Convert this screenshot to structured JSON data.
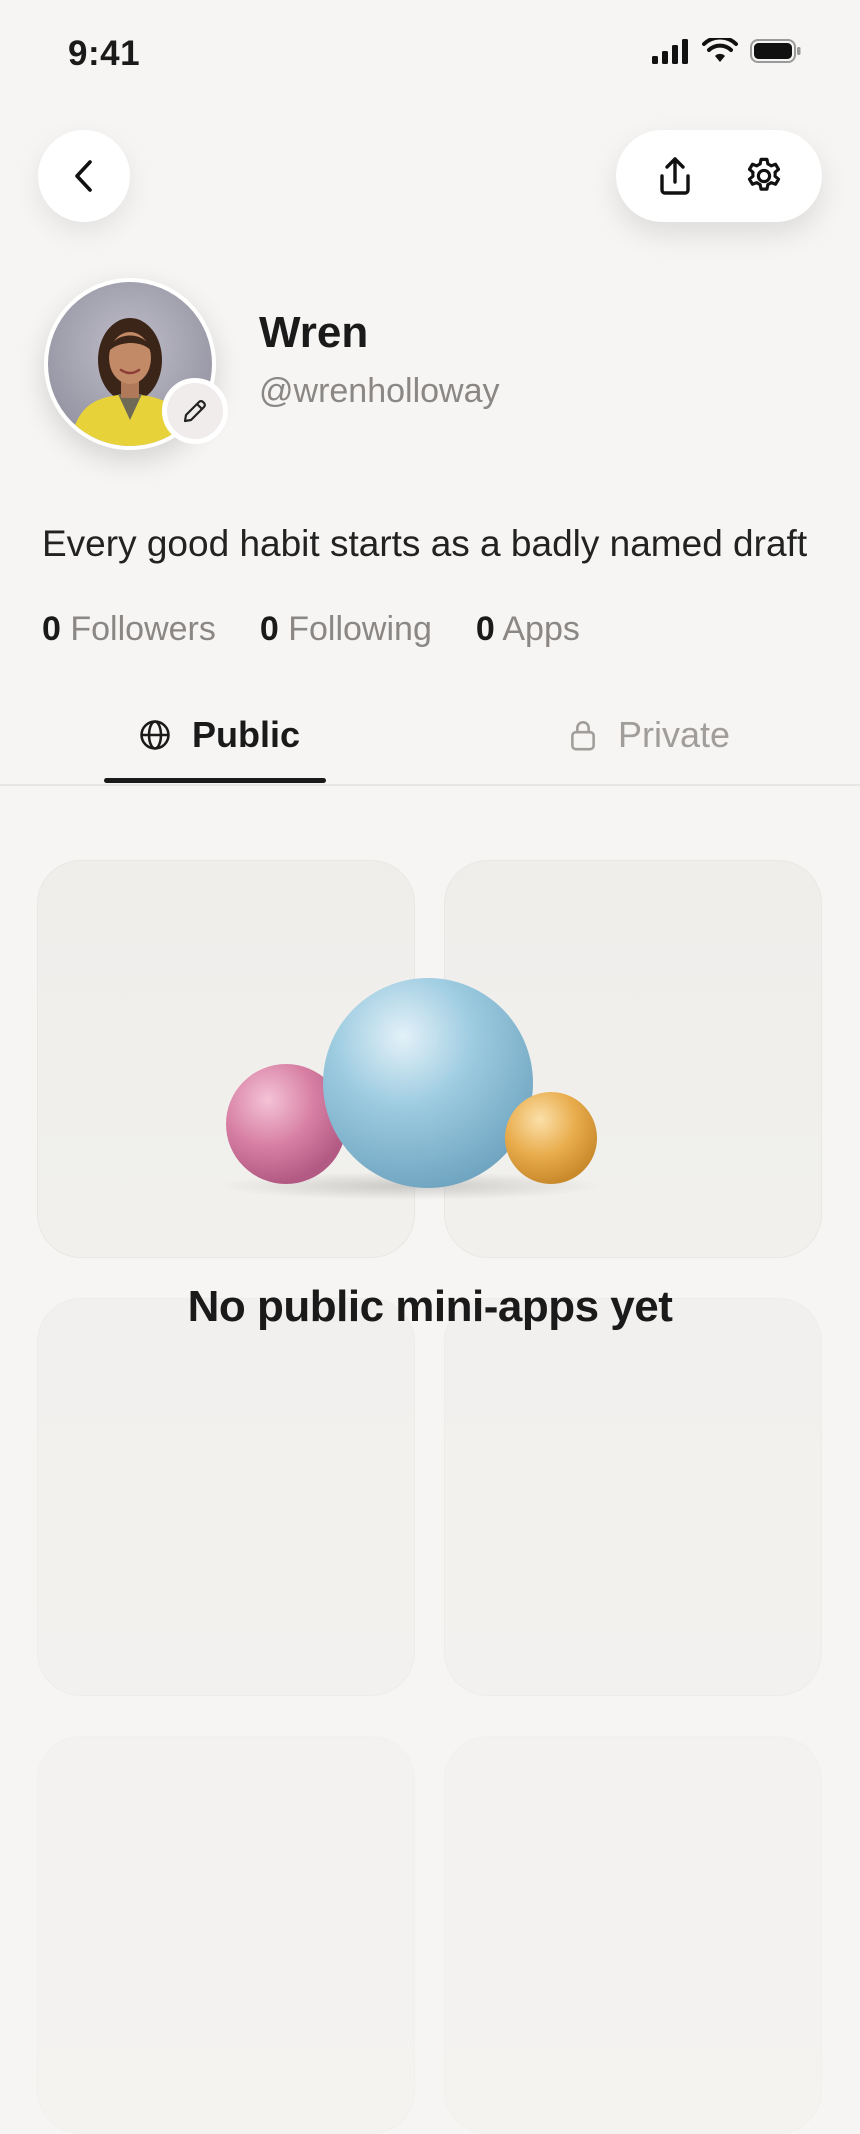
{
  "status_bar": {
    "time": "9:41"
  },
  "profile": {
    "name": "Wren",
    "handle": "@wrenholloway",
    "bio": "Every good habit starts as a badly named draft"
  },
  "stats": [
    {
      "count": "0",
      "label": "Followers"
    },
    {
      "count": "0",
      "label": "Following"
    },
    {
      "count": "0",
      "label": "Apps"
    }
  ],
  "tabs": [
    {
      "label": "Public",
      "icon": "globe-icon",
      "active": true
    },
    {
      "label": "Private",
      "icon": "lock-icon",
      "active": false
    }
  ],
  "empty_state": {
    "title": "No public mini-apps yet"
  },
  "colors": {
    "background": "#f6f5f3",
    "orb_pink": "#d77fa3",
    "orb_blue": "#8fc0d8",
    "orb_orange": "#e7a94a"
  },
  "icons": {
    "back": "chevron-left-icon",
    "share": "share-icon",
    "settings": "gear-icon",
    "edit": "pencil-icon"
  }
}
